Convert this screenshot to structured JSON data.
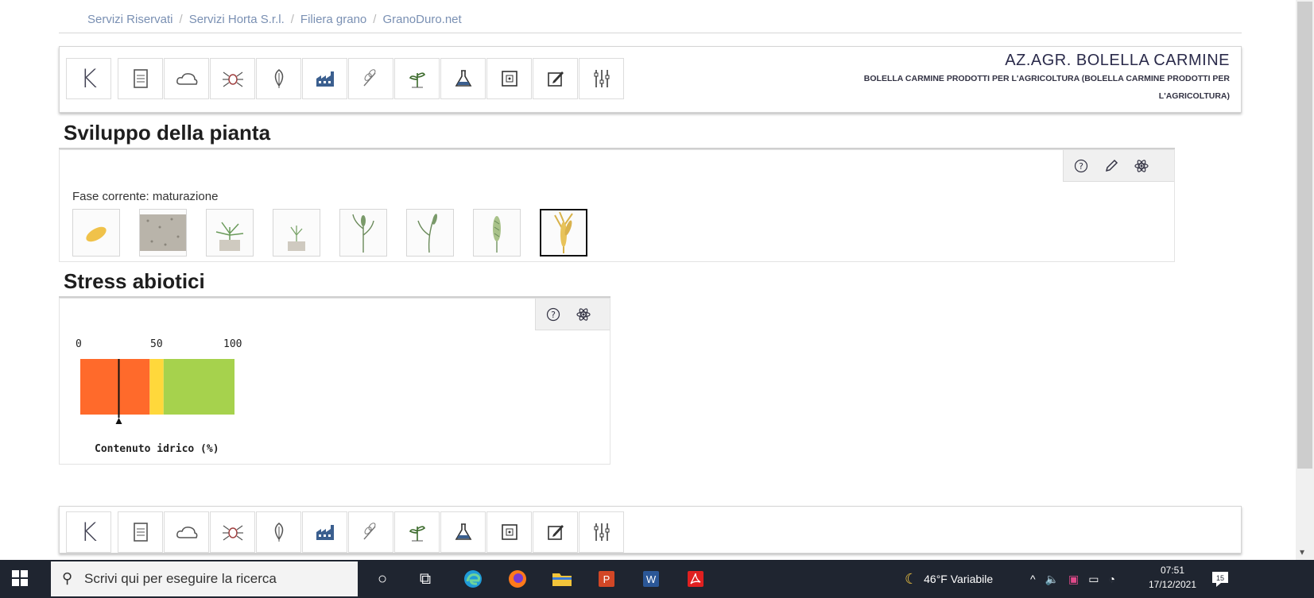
{
  "breadcrumb": [
    "Servizi Riservati",
    "Servizi Horta S.r.l.",
    "Filiera grano",
    "GranoDuro.net"
  ],
  "toolbar": {
    "icons": [
      "k-logo-icon",
      "document-icon",
      "cloud-icon",
      "bug-icon",
      "leaf-icon",
      "factory-icon",
      "wheat-icon",
      "plant-icon",
      "flask-icon",
      "map-icon",
      "edit-icon",
      "sliders-icon"
    ]
  },
  "company": {
    "name": "AZ.AGR. BOLELLA CARMINE",
    "subtitle": "BOLELLA CARMINE PRODOTTI PER L'AGRICOLTURA (BOLELLA CARMINE PRODOTTI PER L'AGRICOLTURA)"
  },
  "plant": {
    "title": "Sviluppo della pianta",
    "phase_label": "Fase corrente: maturazione",
    "phases": [
      "seed",
      "soil",
      "emergence",
      "tillering",
      "stem-elongation",
      "heading",
      "flowering",
      "ripening"
    ],
    "active_phase": 7
  },
  "stress": {
    "title": "Stress abiotici",
    "ticks": [
      "0",
      "50",
      "100"
    ],
    "caption": "Contenuto idrico (%)",
    "gauge": {
      "min": 0,
      "max": 100,
      "value": 25,
      "bands": [
        {
          "from": 0,
          "to": 45,
          "color": "#ff6a2b"
        },
        {
          "from": 45,
          "to": 54,
          "color": "#ffd83b"
        },
        {
          "from": 54,
          "to": 100,
          "color": "#a6d24d"
        }
      ]
    }
  },
  "taskbar": {
    "search_placeholder": "Scrivi qui per eseguire la ricerca",
    "weather": "46°F Variabile",
    "time": "07:51",
    "date": "17/12/2021",
    "notifications": "15"
  }
}
